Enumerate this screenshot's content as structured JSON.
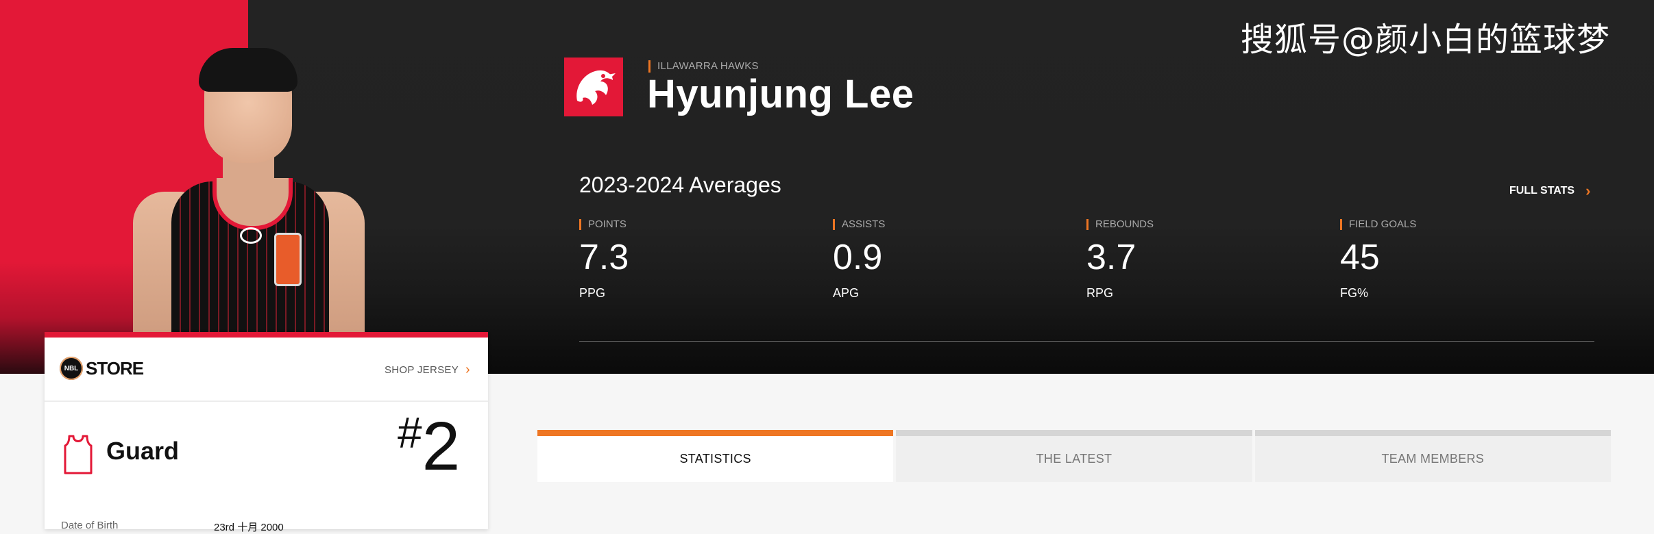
{
  "watermark": "搜狐号@颜小白的篮球梦",
  "team": {
    "name": "ILLAWARRA HAWKS"
  },
  "player": {
    "name": "Hyunjung Lee"
  },
  "averages": {
    "title": "2023-2024 Averages",
    "full_stats_label": "FULL STATS",
    "stats": [
      {
        "label": "POINTS",
        "value": "7.3",
        "unit": "PPG"
      },
      {
        "label": "ASSISTS",
        "value": "0.9",
        "unit": "APG"
      },
      {
        "label": "REBOUNDS",
        "value": "3.7",
        "unit": "RPG"
      },
      {
        "label": "FIELD GOALS",
        "value": "45",
        "unit": "FG%"
      }
    ]
  },
  "card": {
    "store_badge": "NBL",
    "store_label": "STORE",
    "shop_jersey_label": "SHOP JERSEY",
    "position": "Guard",
    "number_hash": "#",
    "number": "2",
    "dob_label": "Date of Birth",
    "dob_value": "23rd 十月 2000"
  },
  "tabs": [
    {
      "label": "STATISTICS",
      "active": true
    },
    {
      "label": "THE LATEST",
      "active": false
    },
    {
      "label": "TEAM MEMBERS",
      "active": false
    }
  ],
  "colors": {
    "team_red": "#e31837",
    "accent_orange": "#ee7623",
    "hero_dark": "#222222"
  },
  "icons": {
    "team_logo": "hawk-icon",
    "position": "jersey-icon",
    "chevron": "chevron-right-icon"
  }
}
